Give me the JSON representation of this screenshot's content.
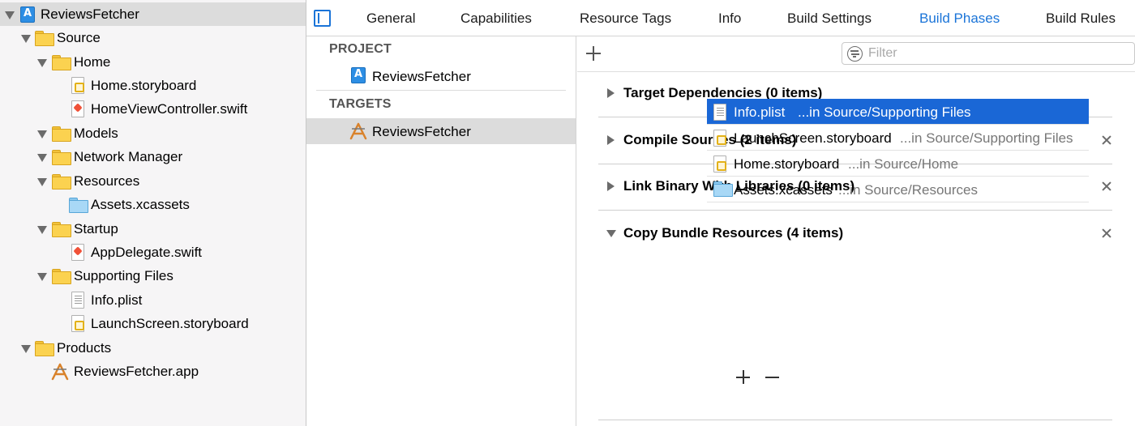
{
  "navigator": {
    "items": [
      {
        "label": "ReviewsFetcher",
        "icon": "project-icon"
      },
      {
        "label": "Source",
        "icon": "folder-icon"
      },
      {
        "label": "Home",
        "icon": "folder-icon"
      },
      {
        "label": "Home.storyboard",
        "icon": "storyboard-icon"
      },
      {
        "label": "HomeViewController.swift",
        "icon": "swift-file-icon"
      },
      {
        "label": "Models",
        "icon": "folder-icon"
      },
      {
        "label": "Network Manager",
        "icon": "folder-icon"
      },
      {
        "label": "Resources",
        "icon": "folder-icon"
      },
      {
        "label": "Assets.xcassets",
        "icon": "asset-catalog-icon"
      },
      {
        "label": "Startup",
        "icon": "folder-icon"
      },
      {
        "label": "AppDelegate.swift",
        "icon": "swift-file-icon"
      },
      {
        "label": "Supporting Files",
        "icon": "folder-icon"
      },
      {
        "label": "Info.plist",
        "icon": "plist-icon"
      },
      {
        "label": "LaunchScreen.storyboard",
        "icon": "storyboard-icon"
      },
      {
        "label": "Products",
        "icon": "folder-icon"
      },
      {
        "label": "ReviewsFetcher.app",
        "icon": "app-product-icon"
      }
    ]
  },
  "tabs": [
    "General",
    "Capabilities",
    "Resource Tags",
    "Info",
    "Build Settings",
    "Build Phases",
    "Build Rules"
  ],
  "active_tab": "Build Phases",
  "targets_pane": {
    "project_header": "PROJECT",
    "project_item": "ReviewsFetcher",
    "targets_header": "TARGETS",
    "target_item": "ReviewsFetcher"
  },
  "filter": {
    "placeholder": "Filter"
  },
  "phases": [
    {
      "title": "Target Dependencies (0 items)",
      "expanded": false,
      "removable": false
    },
    {
      "title": "Compile Sources (2 items)",
      "expanded": false,
      "removable": true
    },
    {
      "title": "Link Binary With Libraries (0 items)",
      "expanded": false,
      "removable": true
    },
    {
      "title": "Copy Bundle Resources (4 items)",
      "expanded": true,
      "removable": true
    }
  ],
  "bundle_resources": [
    {
      "name": "Info.plist",
      "path": "...in Source/Supporting Files",
      "icon": "plist-icon"
    },
    {
      "name": "LaunchScreen.storyboard",
      "path": "...in Source/Supporting Files",
      "icon": "storyboard-icon"
    },
    {
      "name": "Home.storyboard",
      "path": "...in Source/Home",
      "icon": "storyboard-icon"
    },
    {
      "name": "Assets.xcassets",
      "path": "...in Source/Resources",
      "icon": "asset-catalog-icon"
    }
  ],
  "colors": {
    "accent": "#1a74d8",
    "selection": "#1a67d6",
    "folder": "#fbd250"
  }
}
